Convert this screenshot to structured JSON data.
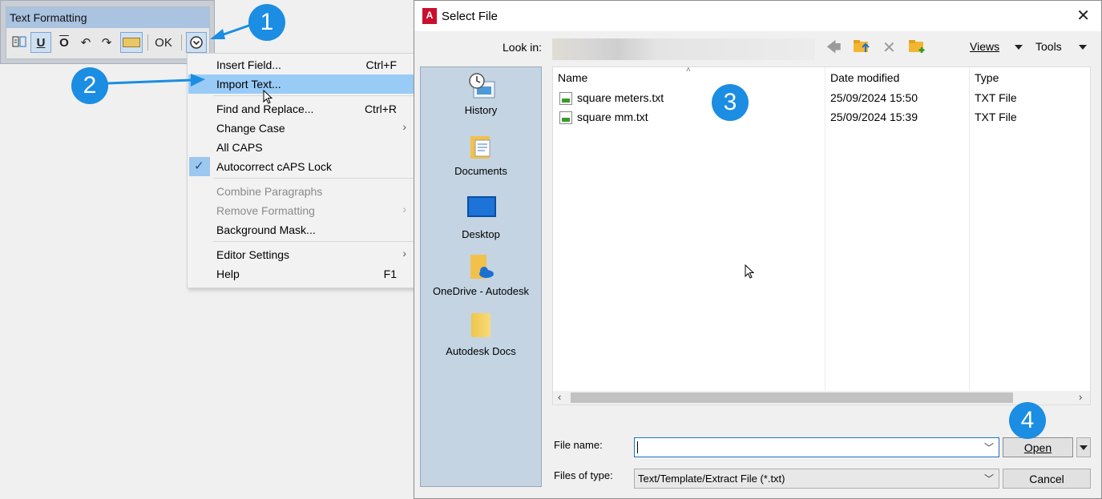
{
  "toolbar": {
    "title": "Text Formatting",
    "underline_label": "U",
    "overline_label": "O",
    "undo_icon": "undo-icon",
    "redo_icon": "redo-icon",
    "ok_label": "OK",
    "options_icon": "chevron-down-circle-icon"
  },
  "menu": {
    "items": [
      {
        "label": "Insert Field...",
        "shortcut": "Ctrl+F"
      },
      {
        "label": "Import Text...",
        "shortcut": ""
      },
      {
        "label": "Find and Replace...",
        "shortcut": "Ctrl+R"
      },
      {
        "label": "Change Case",
        "shortcut": ""
      },
      {
        "label": "All CAPS",
        "shortcut": ""
      },
      {
        "label": "Autocorrect cAPS Lock",
        "shortcut": ""
      },
      {
        "label": "Combine Paragraphs",
        "shortcut": ""
      },
      {
        "label": "Remove Formatting",
        "shortcut": ""
      },
      {
        "label": "Background Mask...",
        "shortcut": ""
      },
      {
        "label": "Editor Settings",
        "shortcut": ""
      },
      {
        "label": "Help",
        "shortcut": "F1"
      }
    ]
  },
  "dialog": {
    "title": "Select File",
    "app_icon_letter": "A",
    "look_in_label": "Look in:",
    "views_label": "Views",
    "tools_label": "Tools",
    "places": [
      {
        "label": "History"
      },
      {
        "label": "Documents"
      },
      {
        "label": "Desktop"
      },
      {
        "label": "OneDrive - Autodesk"
      },
      {
        "label": "Autodesk Docs"
      }
    ],
    "columns": {
      "name": "Name",
      "date": "Date modified",
      "type": "Type"
    },
    "files": [
      {
        "name": "square meters.txt",
        "date": "25/09/2024 15:50",
        "type": "TXT File"
      },
      {
        "name": "square mm.txt",
        "date": "25/09/2024 15:39",
        "type": "TXT File"
      }
    ],
    "file_name_label": "File name:",
    "file_name_value": "",
    "files_of_type_label": "Files of type:",
    "files_of_type_value": "Text/Template/Extract File (*.txt)",
    "open_label": "Open",
    "cancel_label": "Cancel"
  },
  "annotations": [
    "1",
    "2",
    "3",
    "4"
  ],
  "colors": {
    "accent": "#1b8de2",
    "menu_highlight": "#99cbf7",
    "places_bg": "#c4d4e2"
  }
}
